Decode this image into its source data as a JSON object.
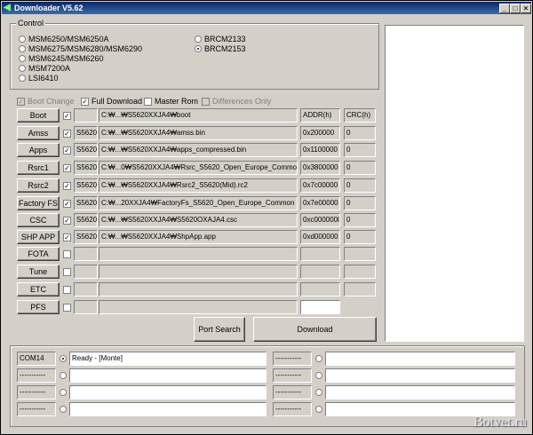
{
  "window": {
    "title": "Downloader V5.62"
  },
  "control": {
    "legend": "Control",
    "radios_left": [
      {
        "label": "MSM6250/MSM6250A",
        "selected": false
      },
      {
        "label": "MSM6275/MSM6280/MSM6290",
        "selected": false
      },
      {
        "label": "MSM6245/MSM6260",
        "selected": false
      },
      {
        "label": "MSM7200A",
        "selected": false
      },
      {
        "label": "LSI6410",
        "selected": false
      }
    ],
    "radios_right": [
      {
        "label": "BRCM2133",
        "selected": false
      },
      {
        "label": "BRCM2153",
        "selected": true
      }
    ]
  },
  "options": {
    "boot_change": "Boot Change",
    "full_download": "Full Download",
    "master_rom": "Master Rom",
    "differences_only": "Differences Only"
  },
  "columns": {
    "addr": "ADDR(h)",
    "crc": "CRC(h)"
  },
  "rows": [
    {
      "name": "Boot",
      "checked": true,
      "model": "",
      "path": "C:₩...₩S5620XXJA4₩boot",
      "addr": "",
      "crc": ""
    },
    {
      "name": "Amss",
      "checked": true,
      "model": "S5620",
      "path": "C:₩...₩S5620XXJA4₩amss.bin",
      "addr": "0x200000",
      "crc": "0"
    },
    {
      "name": "Apps",
      "checked": true,
      "model": "S5620",
      "path": "C:₩...₩S5620XXJA4₩apps_compressed.bin",
      "addr": "0x1100000",
      "crc": "0"
    },
    {
      "name": "Rsrc1",
      "checked": true,
      "model": "S5620",
      "path": "C:₩...0₩S5620XXJA4₩Rsrc_S5620_Open_Europe_Commo",
      "addr": "0x3800000",
      "crc": "0"
    },
    {
      "name": "Rsrc2",
      "checked": true,
      "model": "S5620",
      "path": "C:₩...₩S5620XXJA4₩Rsrc2_S5620(Mid).rc2",
      "addr": "0x7c00000",
      "crc": "0"
    },
    {
      "name": "Factory FS",
      "checked": true,
      "model": "S5620",
      "path": "C:₩...20XXJA4₩FactoryFs_S5620_Open_Europe_Common",
      "addr": "0x7e00000",
      "crc": "0"
    },
    {
      "name": "CSC",
      "checked": true,
      "model": "S5620",
      "path": "C:₩...₩S5620XXJA4₩S5620OXAJA4.csc",
      "addr": "0xc0000000",
      "crc": "0"
    },
    {
      "name": "SHP APP",
      "checked": true,
      "model": "S5620",
      "path": "C:₩...₩S5620XXJA4₩ShpApp.app",
      "addr": "0xd000000",
      "crc": "0"
    },
    {
      "name": "FOTA",
      "checked": false,
      "model": "",
      "path": "",
      "addr": "",
      "crc": ""
    },
    {
      "name": "Tune",
      "checked": false,
      "model": "",
      "path": "",
      "addr": "",
      "crc": ""
    },
    {
      "name": "ETC",
      "checked": false,
      "model": "",
      "path": "",
      "addr": "",
      "crc": ""
    },
    {
      "name": "PFS",
      "checked": false,
      "model": "",
      "path": "",
      "addr": "",
      "crc": ""
    }
  ],
  "buttons": {
    "port_search": "Port Search",
    "download": "Download"
  },
  "ports": [
    {
      "port": "COM14",
      "status": "Ready - [Monte]",
      "selected": true
    },
    {
      "port": "-----------",
      "status": "",
      "selected": false
    },
    {
      "port": "-----------",
      "status": "",
      "selected": false
    },
    {
      "port": "-----------",
      "status": "",
      "selected": false
    },
    {
      "port": "-----------",
      "status": "",
      "selected": false
    },
    {
      "port": "-----------",
      "status": "",
      "selected": false
    },
    {
      "port": "-----------",
      "status": "",
      "selected": false
    },
    {
      "port": "-----------",
      "status": "",
      "selected": false
    }
  ],
  "watermark": "Botvet.ru",
  "icons": {
    "app": "download-arrow-icon",
    "minimize": "minimize-icon",
    "maximize": "maximize-icon",
    "close": "close-icon"
  }
}
